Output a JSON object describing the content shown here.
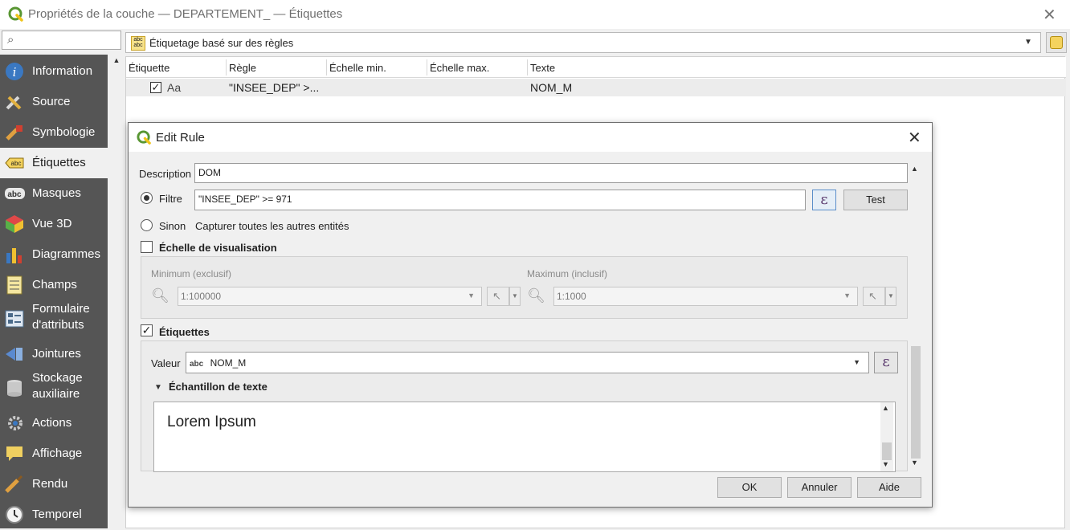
{
  "window": {
    "title": "Propriétés de la couche — DEPARTEMENT_ — Étiquettes",
    "close": "✕"
  },
  "search": {
    "placeholder": ""
  },
  "sidebar": {
    "items": [
      {
        "label": "Information",
        "icon": "info-icon"
      },
      {
        "label": "Source",
        "icon": "source-tools-icon"
      },
      {
        "label": "Symbologie",
        "icon": "paintbrush-icon"
      },
      {
        "label": "Étiquettes",
        "icon": "labels-abc-icon"
      },
      {
        "label": "Masques",
        "icon": "mask-abc-icon"
      },
      {
        "label": "Vue 3D",
        "icon": "cube-3d-icon"
      },
      {
        "label": "Diagrammes",
        "icon": "diagram-icon"
      },
      {
        "label": "Champs",
        "icon": "fields-icon"
      },
      {
        "label": "Formulaire d'attributs",
        "icon": "form-icon"
      },
      {
        "label": "Jointures",
        "icon": "join-icon"
      },
      {
        "label": "Stockage auxiliaire",
        "icon": "database-icon"
      },
      {
        "label": "Actions",
        "icon": "gear-actions-icon"
      },
      {
        "label": "Affichage",
        "icon": "speech-bubble-icon"
      },
      {
        "label": "Rendu",
        "icon": "brush-render-icon"
      },
      {
        "label": "Temporel",
        "icon": "clock-icon"
      }
    ]
  },
  "labeling_mode": {
    "label": "Étiquetage basé sur des règles",
    "icon_text": "abc abc"
  },
  "rules_table": {
    "headers": [
      "Étiquette",
      "Règle",
      "Échelle min.",
      "Échelle max.",
      "Texte"
    ],
    "rows": [
      {
        "checked": "✓",
        "label_preview": "Aa",
        "rule": "\"INSEE_DEP\" >...",
        "scale_min": "",
        "scale_max": "",
        "text": "NOM_M"
      }
    ]
  },
  "dialog": {
    "title": "Edit Rule",
    "close": "✕",
    "description_label": "Description",
    "description_value": "DOM",
    "filter_label": "Filtre",
    "filter_value": "\"INSEE_DEP\" >= 971",
    "test_button": "Test",
    "else_label": "Sinon",
    "else_text": "Capturer toutes les autres entités",
    "scale_section": "Échelle de visualisation",
    "scale_min_label": "Minimum (exclusif)",
    "scale_min_value": "1:100000",
    "scale_max_label": "Maximum (inclusif)",
    "scale_max_value": "1:1000",
    "labels_section": "Étiquettes",
    "labels_checked": "✓",
    "value_label": "Valeur",
    "value_type": "abc",
    "value_field": "NOM_M",
    "sample_section": "Échantillon de texte",
    "sample_text": "Lorem Ipsum",
    "epsilon": "ε",
    "ok": "OK",
    "cancel": "Annuler",
    "help": "Aide"
  },
  "colors": {
    "sidebar_bg": "#555555",
    "qgis_green": "#589632",
    "qgis_yellow": "#f0c419"
  }
}
